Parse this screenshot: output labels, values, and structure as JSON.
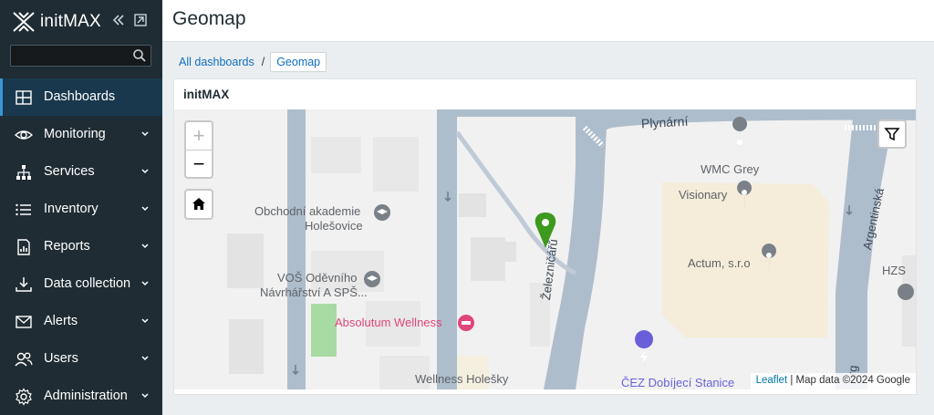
{
  "app": {
    "logo_text": "initMAX",
    "page_title": "Geomap"
  },
  "search": {
    "value": "",
    "placeholder": ""
  },
  "sidebar": {
    "items": [
      {
        "label": "Dashboards",
        "icon": "dashboards-icon",
        "active": true,
        "chevron": false
      },
      {
        "label": "Monitoring",
        "icon": "eye-icon",
        "chevron": true
      },
      {
        "label": "Services",
        "icon": "services-icon",
        "chevron": true
      },
      {
        "label": "Inventory",
        "icon": "list-icon",
        "chevron": true
      },
      {
        "label": "Reports",
        "icon": "report-icon",
        "chevron": true
      },
      {
        "label": "Data collection",
        "icon": "download-icon",
        "chevron": true
      },
      {
        "label": "Alerts",
        "icon": "envelope-icon",
        "chevron": true
      },
      {
        "label": "Users",
        "icon": "users-icon",
        "chevron": true
      },
      {
        "label": "Administration",
        "icon": "gear-icon",
        "chevron": true
      }
    ]
  },
  "breadcrumb": {
    "parent": "All dashboards",
    "separator": "/",
    "current": "Geomap"
  },
  "widget": {
    "title": "initMAX",
    "map": {
      "zoom_in": "+",
      "zoom_out": "−",
      "marker_color": "#3e9a1e",
      "attribution_link": "Leaflet",
      "attribution_text": " | Map data ©2024 Google",
      "labels": {
        "street1": "Plynární",
        "street2": "Železničářů",
        "street3": "Argentinská",
        "street4": "Arg",
        "poi1a": "Obchodní akademie",
        "poi1b": "Holešovice",
        "poi2a": "VOŠ Oděvního",
        "poi2b": "Návrhářství A SPŠ...",
        "poi3": "Absolutum Wellness",
        "poi4": "Wellness Holešky",
        "poi5": "WMC Grey",
        "poi6": "Visionary",
        "poi7": "Actum, s.r.o",
        "poi8": "ČEZ Dobíjecí Stanice",
        "poi9": "HZS"
      }
    }
  },
  "colors": {
    "sidebar_bg": "#1f2c33",
    "active_bg": "#19384d",
    "accent": "#3b95d4",
    "link": "#0d6fbf",
    "wellness_pink": "#e0457b",
    "ev_purple": "#6a5fd9"
  }
}
